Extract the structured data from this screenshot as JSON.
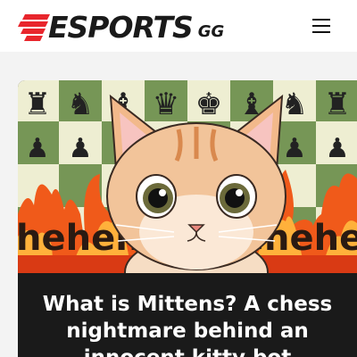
{
  "header": {
    "logo_text": "ESPORTS",
    "logo_suffix": "GG",
    "menu_icon": "hamburger-menu-icon",
    "brand_color": "#e8262d"
  },
  "article": {
    "image_caption_text": "heheheheheheheh",
    "title": "What is Mittens? A chess nightmare behind an innocent kitty bot"
  }
}
